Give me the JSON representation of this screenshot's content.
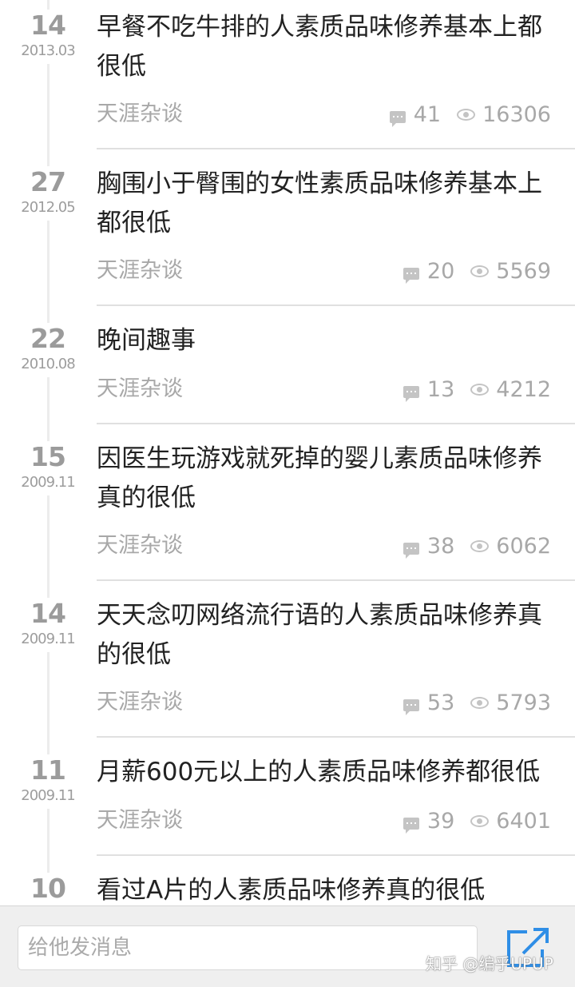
{
  "feed": {
    "items": [
      {
        "day": "14",
        "year_month": "2013.03",
        "title": "早餐不吃牛排的人素质品味修养基本上都很低",
        "source": "天涯杂谈",
        "comments": "41",
        "views": "16306"
      },
      {
        "day": "27",
        "year_month": "2012.05",
        "title": "胸围小于臀围的女性素质品味修养基本上都很低",
        "source": "天涯杂谈",
        "comments": "20",
        "views": "5569"
      },
      {
        "day": "22",
        "year_month": "2010.08",
        "title": "晚间趣事",
        "source": "天涯杂谈",
        "comments": "13",
        "views": "4212"
      },
      {
        "day": "15",
        "year_month": "2009.11",
        "title": "因医生玩游戏就死掉的婴儿素质品味修养真的很低",
        "source": "天涯杂谈",
        "comments": "38",
        "views": "6062"
      },
      {
        "day": "14",
        "year_month": "2009.11",
        "title": "天天念叨网络流行语的人素质品味修养真的很低",
        "source": "天涯杂谈",
        "comments": "53",
        "views": "5793"
      },
      {
        "day": "11",
        "year_month": "2009.11",
        "title": "月薪600元以上的人素质品味修养都很低",
        "source": "天涯杂谈",
        "comments": "39",
        "views": "6401"
      },
      {
        "day": "10",
        "year_month": "",
        "title": "看过A片的人素质品味修养真的很低",
        "source": "",
        "comments": "",
        "views": ""
      }
    ]
  },
  "composer": {
    "placeholder": "给他发消息"
  },
  "watermark": "知乎 @编乎UPUP",
  "colors": {
    "accent": "#2f8ee6",
    "meta_text": "#a8a8a8",
    "date_text": "#9b9b9b"
  },
  "icons": {
    "comment": "comment-bubble-icon",
    "views": "eye-icon",
    "share": "share-external-icon"
  }
}
